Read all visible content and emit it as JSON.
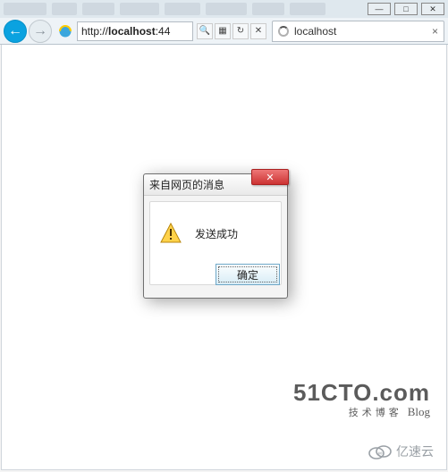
{
  "topStrip": {
    "winMin": "—",
    "winMax": "□",
    "winClose": "✕"
  },
  "nav": {
    "backArrow": "←",
    "fwdArrow": "→",
    "url_prefix": "http://",
    "url_host": "localhost",
    "url_suffix": ":44",
    "searchGlyph": "🔍",
    "refreshGlyph": "↻",
    "stopGlyph": "✕",
    "compatGlyph": "▦"
  },
  "tab": {
    "title": "localhost",
    "closeGlyph": "×"
  },
  "dialog": {
    "title": "来自网页的消息",
    "closeGlyph": "✕",
    "message": "发送成功",
    "okLabel": "确定"
  },
  "watermark51cto": {
    "big": "51CTO.com",
    "sub_cn": "技术博客",
    "sub_blog": "Blog"
  },
  "watermarkYisu": {
    "text": "亿速云"
  }
}
